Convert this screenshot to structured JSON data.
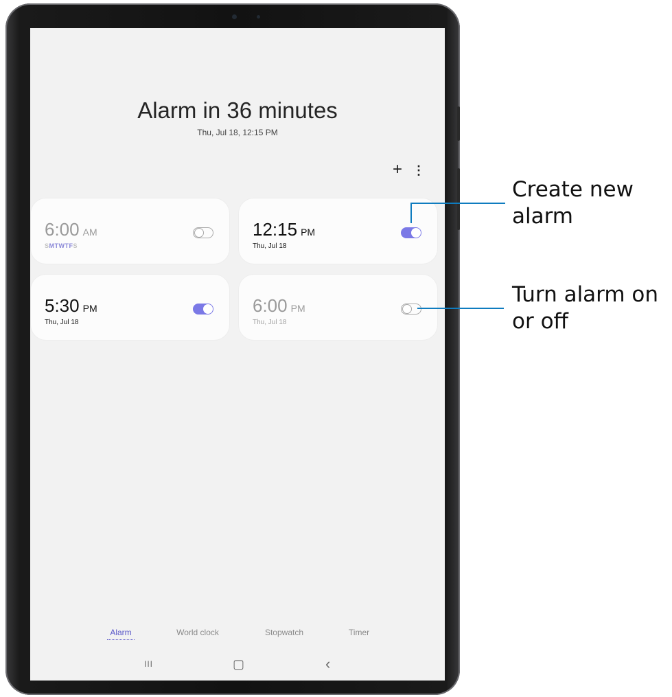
{
  "header": {
    "title": "Alarm in 36 minutes",
    "subtitle": "Thu, Jul 18, 12:15 PM"
  },
  "toolbar": {
    "add_icon": "+",
    "more_icon": "⋮"
  },
  "alarms": [
    {
      "time": "6:00",
      "ampm": "AM",
      "days_active": "SMTWTF",
      "days_weekend_start": "S",
      "days_weekend_end": "S",
      "enabled": false,
      "repeat": true
    },
    {
      "time": "12:15",
      "ampm": "PM",
      "date": "Thu, Jul 18",
      "enabled": true
    },
    {
      "time": "5:30",
      "ampm": "PM",
      "date": "Thu, Jul 18",
      "enabled": true
    },
    {
      "time": "6:00",
      "ampm": "PM",
      "date": "Thu, Jul 18",
      "enabled": false
    }
  ],
  "tabs": [
    {
      "label": "Alarm",
      "active": true
    },
    {
      "label": "World clock",
      "active": false
    },
    {
      "label": "Stopwatch",
      "active": false
    },
    {
      "label": "Timer",
      "active": false
    }
  ],
  "navbar": {
    "recents": "III",
    "home": "▢",
    "back": "‹"
  },
  "callouts": {
    "create_line1": "Create new",
    "create_line2": "alarm",
    "toggle_line1": "Turn alarm on",
    "toggle_line2": "or off"
  },
  "colors": {
    "accent": "#7b79e6",
    "callout_line": "#0f7cbf",
    "screen_bg": "#f2f2f2"
  }
}
